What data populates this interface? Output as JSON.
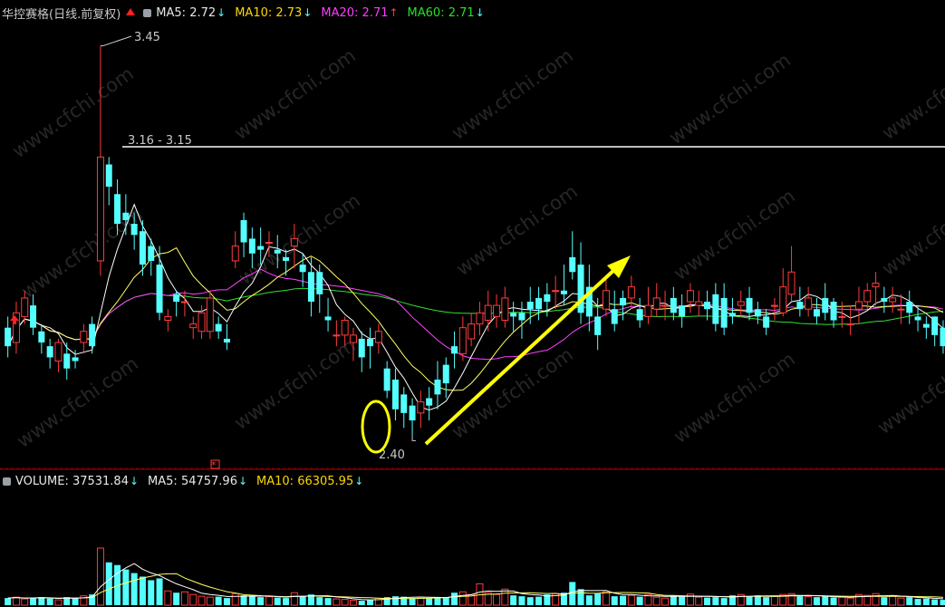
{
  "header": {
    "stock_name": "华控赛格",
    "period": "(日线.前复权)",
    "ma5": {
      "label": "MA5: 2.72",
      "dir": "↓",
      "color": "#e8e8e8"
    },
    "ma10": {
      "label": "MA10: 2.73",
      "dir": "↓",
      "color": "#ffd700"
    },
    "ma20": {
      "label": "MA20: 2.71",
      "dir": "↑",
      "color": "#ff3cff"
    },
    "ma60": {
      "label": "MA60: 2.71",
      "dir": "↓",
      "color": "#28e028"
    }
  },
  "volume_header": {
    "volume": {
      "label": "VOLUME: 37531.84",
      "dir": "↓",
      "color": "#e8e8e8"
    },
    "ma5": {
      "label": "MA5: 54757.96",
      "dir": "↓",
      "color": "#e8e8e8"
    },
    "ma10": {
      "label": "MA10: 66305.95",
      "dir": "↓",
      "color": "#ffd700"
    }
  },
  "annotations": {
    "high_label": "3.45",
    "low_label": "2.40",
    "resistance_label": "3.16 - 3.15",
    "watermark": "www.cfchi.com"
  },
  "colors": {
    "up": "#ff3c3c",
    "down": "#54ffff",
    "ma5": "#ffffff",
    "ma10": "#ffff60",
    "ma20": "#ff40ff",
    "ma60": "#30e030",
    "resistance_line": "#bdbdbd",
    "annotation": "#ffff00",
    "separator": "#aa0000",
    "label_text": "#c8c8c8"
  },
  "chart_data": [
    {
      "type": "candlestick",
      "title": "华控赛格(日线.前复权)",
      "ylim": [
        2.34,
        3.5
      ],
      "series": [
        {
          "name": "K",
          "o": [
            2.69,
            2.65,
            2.72,
            2.75,
            2.68,
            2.64,
            2.6,
            2.62,
            2.61,
            2.65,
            2.7,
            2.87,
            3.13,
            3.05,
            3.0,
            2.97,
            2.95,
            2.91,
            2.86,
            2.71,
            2.78,
            2.76,
            2.69,
            2.68,
            2.68,
            2.7,
            2.66,
            2.87,
            2.98,
            2.93,
            2.91,
            2.92,
            2.9,
            2.88,
            2.91,
            2.86,
            2.84,
            2.84,
            2.72,
            2.67,
            2.67,
            2.65,
            2.66,
            2.66,
            2.65,
            2.58,
            2.55,
            2.51,
            2.48,
            2.46,
            2.5,
            2.55,
            2.59,
            2.64,
            2.62,
            2.66,
            2.7,
            2.71,
            2.72,
            2.71,
            2.73,
            2.73,
            2.76,
            2.77,
            2.78,
            2.79,
            2.79,
            2.88,
            2.86,
            2.8,
            2.72,
            2.74,
            2.74,
            2.77,
            2.77,
            2.74,
            2.72,
            2.74,
            2.75,
            2.77,
            2.75,
            2.76,
            2.75,
            2.76,
            2.78,
            2.77,
            2.73,
            2.75,
            2.77,
            2.74,
            2.72,
            2.75,
            2.73,
            2.78,
            2.76,
            2.74,
            2.74,
            2.77,
            2.76,
            2.72,
            2.7,
            2.74,
            2.76,
            2.8,
            2.77,
            2.76,
            2.74,
            2.76,
            2.72,
            2.7,
            2.72,
            2.69
          ],
          "c": [
            2.64,
            2.73,
            2.77,
            2.69,
            2.65,
            2.61,
            2.65,
            2.58,
            2.6,
            2.68,
            2.64,
            3.15,
            3.07,
            2.97,
            2.98,
            2.94,
            2.86,
            2.87,
            2.73,
            2.72,
            2.76,
            2.76,
            2.7,
            2.73,
            2.77,
            2.68,
            2.65,
            2.91,
            2.92,
            2.89,
            2.9,
            2.92,
            2.89,
            2.87,
            2.93,
            2.84,
            2.76,
            2.78,
            2.71,
            2.67,
            2.71,
            2.67,
            2.61,
            2.64,
            2.68,
            2.52,
            2.47,
            2.46,
            2.44,
            2.49,
            2.48,
            2.51,
            2.54,
            2.62,
            2.69,
            2.7,
            2.73,
            2.75,
            2.75,
            2.77,
            2.72,
            2.71,
            2.74,
            2.74,
            2.76,
            2.79,
            2.78,
            2.84,
            2.73,
            2.72,
            2.67,
            2.79,
            2.7,
            2.75,
            2.8,
            2.71,
            2.75,
            2.77,
            2.75,
            2.73,
            2.72,
            2.79,
            2.76,
            2.74,
            2.7,
            2.69,
            2.72,
            2.76,
            2.73,
            2.72,
            2.69,
            2.75,
            2.8,
            2.84,
            2.74,
            2.77,
            2.72,
            2.73,
            2.71,
            2.72,
            2.7,
            2.76,
            2.79,
            2.81,
            2.76,
            2.77,
            2.74,
            2.73,
            2.71,
            2.69,
            2.67,
            2.64
          ],
          "h": [
            2.72,
            2.76,
            2.79,
            2.78,
            2.7,
            2.66,
            2.66,
            2.65,
            2.63,
            2.7,
            2.72,
            3.45,
            3.15,
            3.09,
            3.05,
            3.0,
            2.98,
            2.93,
            2.91,
            2.74,
            2.79,
            2.79,
            2.72,
            2.75,
            2.79,
            2.72,
            2.7,
            2.95,
            3.0,
            2.96,
            2.96,
            2.95,
            2.94,
            2.9,
            2.97,
            2.89,
            2.88,
            2.86,
            2.77,
            2.71,
            2.72,
            2.69,
            2.68,
            2.69,
            2.7,
            2.6,
            2.58,
            2.53,
            2.5,
            2.52,
            2.53,
            2.6,
            2.61,
            2.68,
            2.72,
            2.73,
            2.76,
            2.79,
            2.78,
            2.8,
            2.76,
            2.76,
            2.8,
            2.8,
            2.81,
            2.83,
            2.86,
            2.95,
            2.92,
            2.86,
            2.77,
            2.82,
            2.79,
            2.79,
            2.83,
            2.77,
            2.8,
            2.81,
            2.79,
            2.8,
            2.78,
            2.81,
            2.79,
            2.79,
            2.81,
            2.81,
            2.77,
            2.79,
            2.8,
            2.76,
            2.74,
            2.77,
            2.85,
            2.91,
            2.8,
            2.8,
            2.77,
            2.81,
            2.77,
            2.76,
            2.75,
            2.8,
            2.81,
            2.84,
            2.8,
            2.8,
            2.78,
            2.79,
            2.75,
            2.72,
            2.72,
            2.71
          ],
          "l": [
            2.61,
            2.62,
            2.7,
            2.67,
            2.62,
            2.58,
            2.57,
            2.55,
            2.58,
            2.62,
            2.62,
            2.83,
            3.02,
            2.94,
            2.94,
            2.9,
            2.83,
            2.83,
            2.71,
            2.68,
            2.72,
            2.72,
            2.66,
            2.66,
            2.66,
            2.66,
            2.63,
            2.85,
            2.88,
            2.85,
            2.86,
            2.88,
            2.85,
            2.83,
            2.85,
            2.8,
            2.72,
            2.73,
            2.68,
            2.64,
            2.64,
            2.6,
            2.57,
            2.58,
            2.62,
            2.5,
            2.44,
            2.42,
            2.4,
            2.42,
            2.44,
            2.47,
            2.5,
            2.58,
            2.6,
            2.64,
            2.67,
            2.68,
            2.69,
            2.69,
            2.68,
            2.66,
            2.7,
            2.71,
            2.72,
            2.74,
            2.75,
            2.82,
            2.7,
            2.68,
            2.63,
            2.72,
            2.68,
            2.71,
            2.74,
            2.69,
            2.7,
            2.72,
            2.71,
            2.71,
            2.69,
            2.73,
            2.72,
            2.71,
            2.68,
            2.67,
            2.7,
            2.72,
            2.71,
            2.7,
            2.67,
            2.71,
            2.72,
            2.76,
            2.72,
            2.72,
            2.7,
            2.71,
            2.69,
            2.69,
            2.67,
            2.7,
            2.74,
            2.75,
            2.73,
            2.73,
            2.7,
            2.7,
            2.68,
            2.66,
            2.64,
            2.62
          ]
        }
      ]
    },
    {
      "type": "bar",
      "title": "VOLUME",
      "ylim": [
        0,
        130000
      ],
      "values": [
        8000,
        9000,
        7000,
        8500,
        9000,
        7500,
        6000,
        9000,
        8000,
        10500,
        12000,
        64000,
        48000,
        45000,
        40000,
        36000,
        32000,
        28000,
        30000,
        16000,
        14000,
        15000,
        12000,
        10000,
        9000,
        9500,
        8000,
        13000,
        11000,
        10000,
        9000,
        9500,
        8500,
        8000,
        14000,
        10000,
        12000,
        9000,
        8000,
        7000,
        6500,
        5500,
        5000,
        6000,
        8000,
        9000,
        10000,
        9500,
        8000,
        9000,
        8000,
        9000,
        8500,
        14000,
        15000,
        12000,
        24000,
        14000,
        12000,
        18000,
        11000,
        10000,
        9000,
        9500,
        12000,
        13000,
        14000,
        26000,
        18000,
        11000,
        13000,
        15000,
        10000,
        10500,
        11000,
        9500,
        12000,
        9000,
        8000,
        11000,
        9500,
        12500,
        9000,
        8500,
        9000,
        8000,
        11000,
        12000,
        9500,
        11000,
        9000,
        10500,
        12000,
        13000,
        10000,
        9500,
        9000,
        10000,
        8500,
        9000,
        8000,
        12000,
        11000,
        13000,
        9000,
        10000,
        8000,
        9000,
        7000,
        7500,
        6500,
        6000
      ]
    }
  ]
}
